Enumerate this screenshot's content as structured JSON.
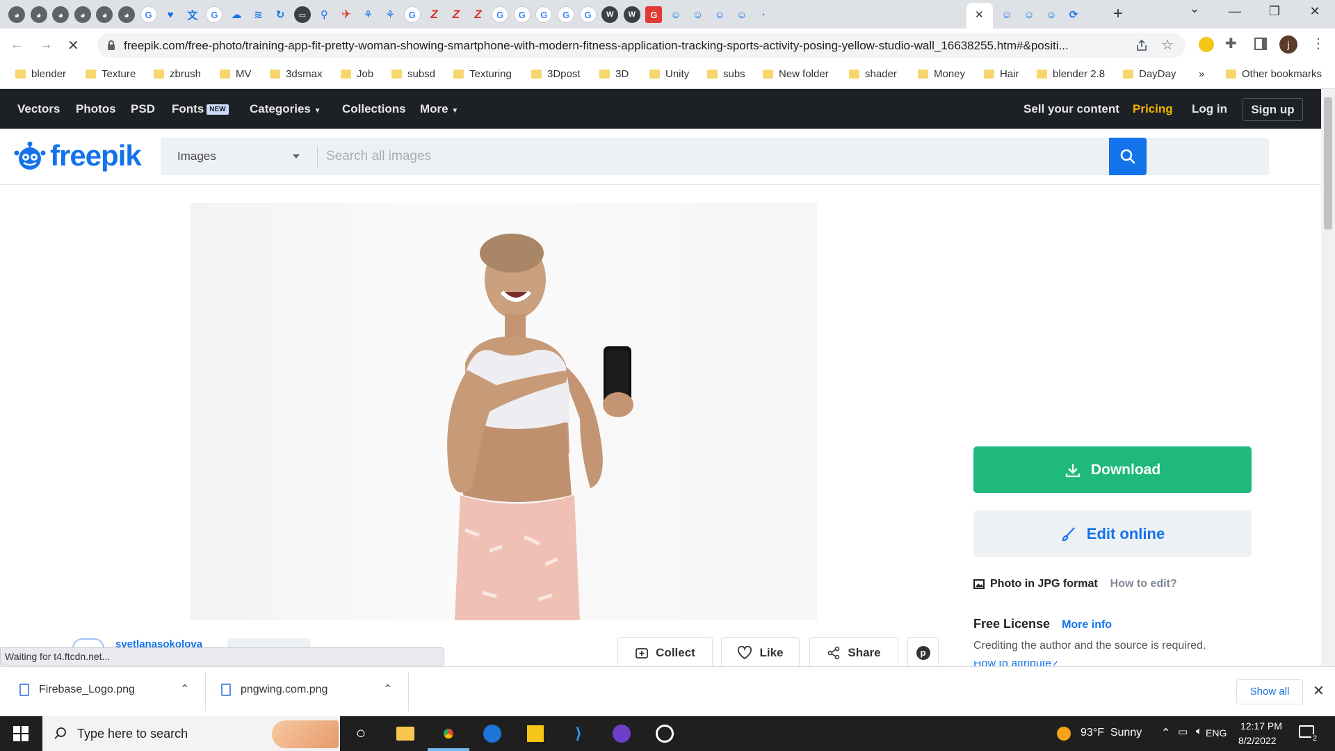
{
  "tabs": {
    "active_close": "✕",
    "new_tab": "+",
    "icons": [
      "globe",
      "globe",
      "globe",
      "globe",
      "globe",
      "globe",
      "google",
      "heart",
      "translate",
      "google",
      "cloud",
      "layers",
      "refresh",
      "monitor",
      "map-pin",
      "rocket",
      "tree",
      "tree",
      "google",
      "z",
      "z",
      "z",
      "google",
      "google",
      "google",
      "google",
      "google",
      "wiki",
      "wiki",
      "g-red",
      "freepik",
      "freepik",
      "freepik",
      "freepik",
      "loading"
    ],
    "trailing_icons": [
      "freepik",
      "freepik",
      "freepik",
      "sync"
    ]
  },
  "window": {
    "minimize": "—",
    "restore": "❐",
    "close": "✕",
    "dropdown": "⌄"
  },
  "address_bar": {
    "url": "freepik.com/free-photo/training-app-fit-pretty-woman-showing-smartphone-with-modern-fitness-application-tracking-sports-activity-posing-yellow-studio-wall_16638255.htm#&positi...",
    "profile_initial": "j"
  },
  "bookmarks": {
    "items": [
      "blender",
      "Texture",
      "zbrush",
      "MV",
      "3dsmax",
      "Job",
      "subsd",
      "Texturing",
      "3Dpost",
      "3D",
      "Unity",
      "subs",
      "New folder",
      "shader",
      "Money",
      "Hair",
      "blender 2.8",
      "DayDay"
    ],
    "more": "»",
    "other": "Other bookmarks"
  },
  "site_nav": {
    "left": [
      "Vectors",
      "Photos",
      "PSD"
    ],
    "fonts": "Fonts",
    "fonts_badge": "NEW",
    "categories": "Categories",
    "collections": "Collections",
    "more": "More",
    "sell": "Sell your content",
    "pricing": "Pricing",
    "login": "Log in",
    "signup": "Sign up"
  },
  "header": {
    "logo": "freepik",
    "search_type": "Images",
    "search_placeholder": "Search all images"
  },
  "resource": {
    "download": "Download",
    "edit_online": "Edit online",
    "format": "Photo in JPG format",
    "how_to_edit": "How to edit?",
    "license_title": "Free License",
    "more_info": "More info",
    "credit_note": "Crediting the author and the source is required.",
    "attribute_partial": "How to attribute?"
  },
  "actions": {
    "collect": "Collect",
    "like": "Like",
    "share": "Share"
  },
  "author": {
    "name": "svetlanasokolova"
  },
  "status_text": "Waiting for t4.ftcdn.net...",
  "downloads": {
    "files": [
      "Firebase_Logo.png",
      "pngwing.com.png"
    ],
    "show_all": "Show all"
  },
  "taskbar": {
    "search_placeholder": "Type here to search",
    "weather": "93°F  Sunny",
    "lang": "ENG",
    "time": "12:17 PM",
    "date": "8/2/2022",
    "notification_count": "2"
  },
  "colors": {
    "brand": "#1273eb",
    "download": "#1fb97b",
    "pricing": "#f7b500",
    "nav_bg": "#1d2024"
  }
}
